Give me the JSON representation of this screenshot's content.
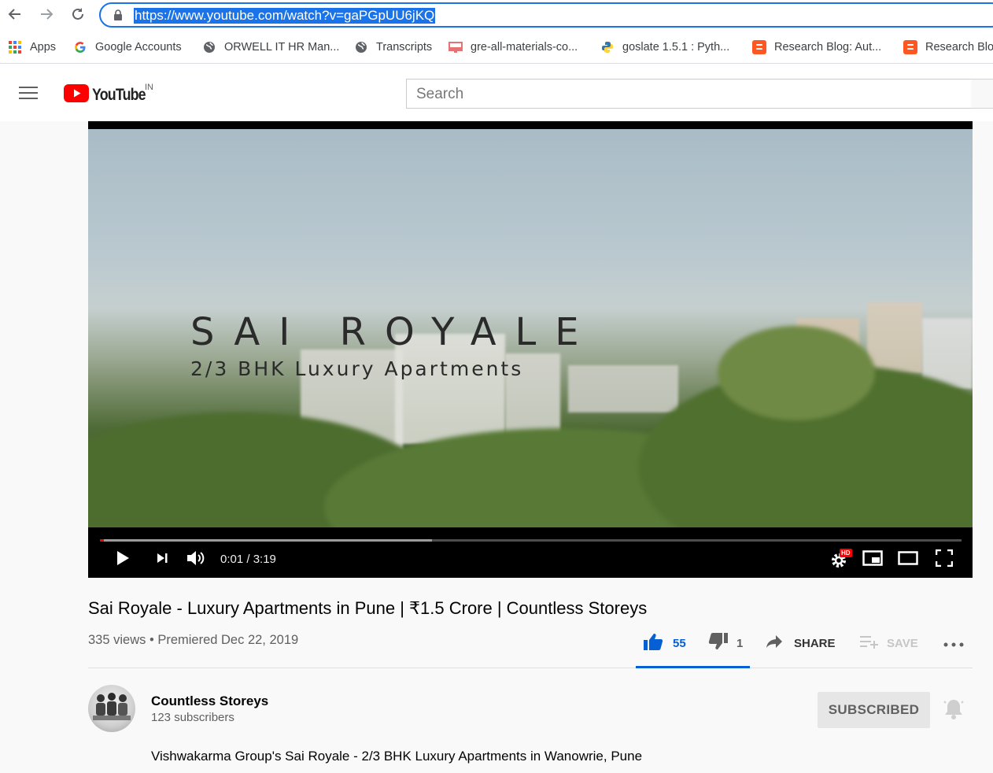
{
  "browser": {
    "url": "https://www.youtube.com/watch?v=gaPGpUU6jKQ"
  },
  "bookmarks": [
    {
      "label": "Apps",
      "icon": "apps-grid-icon"
    },
    {
      "label": "Google Accounts",
      "icon": "google-g-icon"
    },
    {
      "label": "ORWELL IT HR Man...",
      "icon": "globe-icon"
    },
    {
      "label": "Transcripts",
      "icon": "globe-icon"
    },
    {
      "label": "gre-all-materials-co...",
      "icon": "bookmark-page-icon"
    },
    {
      "label": "goslate 1.5.1 : Pyth...",
      "icon": "python-icon"
    },
    {
      "label": "Research Blog: Aut...",
      "icon": "blogger-icon"
    },
    {
      "label": "Research Blo",
      "icon": "blogger-icon"
    }
  ],
  "header": {
    "logo_text": "YouTube",
    "country_code": "IN",
    "search_placeholder": "Search"
  },
  "player": {
    "overlay_title": "SAI ROYALE",
    "overlay_subtitle": "2/3 BHK Luxury Apartments",
    "current_time": "0:01",
    "duration": "3:19",
    "time_display": "0:01 / 3:19",
    "quality_badge": "HD",
    "played_fraction": 0.005,
    "buffered_fraction": 0.385
  },
  "video": {
    "title": "Sai Royale - Luxury Apartments in Pune | ₹1.5 Crore | Countless Storeys",
    "views": "335 views",
    "date": "Premiered Dec 22, 2019",
    "meta_line": "335 views • Premiered Dec 22, 2019",
    "likes": "55",
    "dislikes": "1",
    "share_label": "SHARE",
    "save_label": "SAVE"
  },
  "channel": {
    "name": "Countless Storeys",
    "subscribers": "123 subscribers",
    "subscribe_state": "SUBSCRIBED",
    "description": "Vishwakarma Group's Sai Royale - 2/3 BHK Luxury Apartments in Wanowrie, Pune"
  },
  "colors": {
    "accent_blue": "#065fd4",
    "youtube_red": "#ff0000",
    "omnibox_blue": "#1a73e8"
  }
}
